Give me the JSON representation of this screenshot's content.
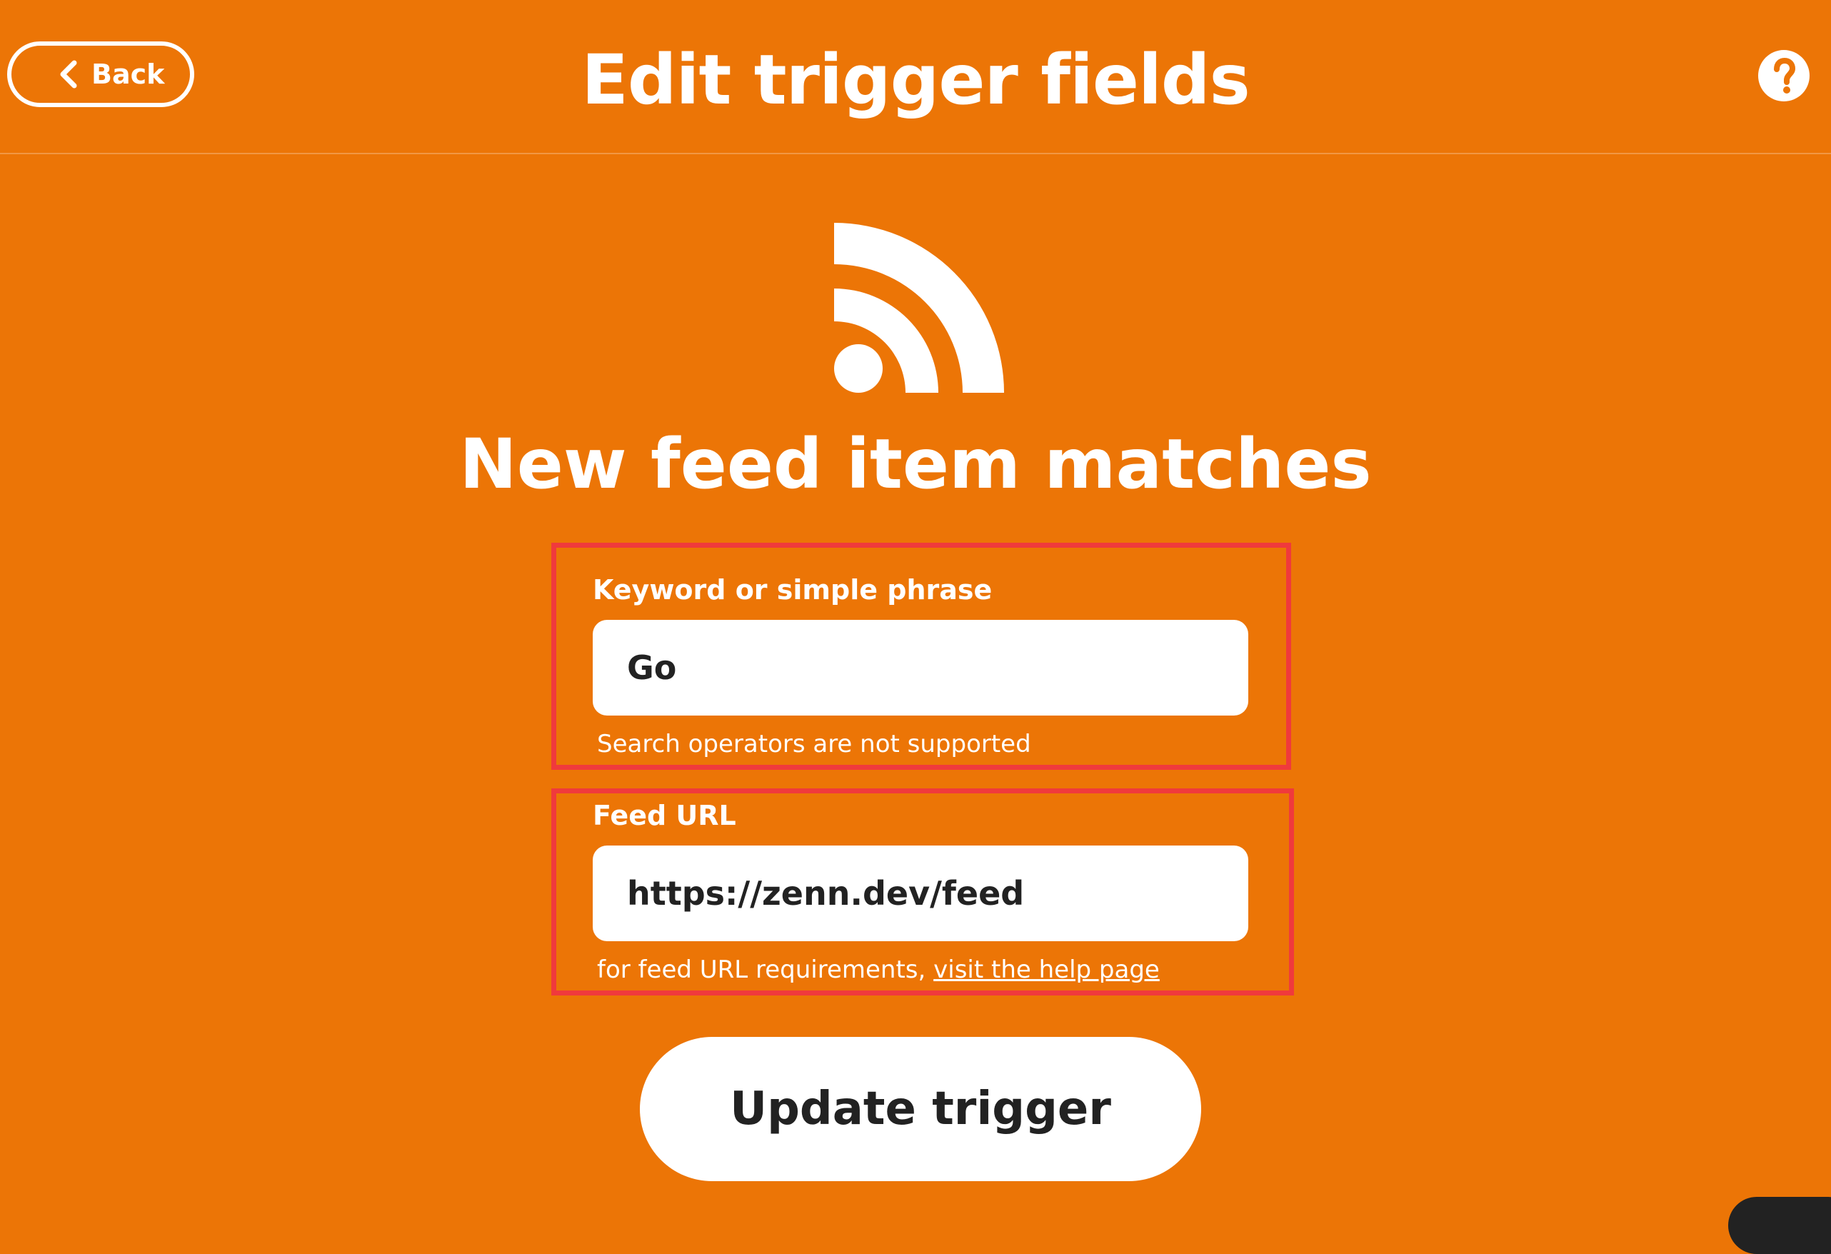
{
  "header": {
    "back_label": "Back",
    "title": "Edit trigger fields",
    "help_icon": "question-circle-icon"
  },
  "trigger": {
    "icon": "rss-feed-icon",
    "title": "New feed item matches"
  },
  "fields": [
    {
      "label": "Keyword or simple phrase",
      "value": "Go",
      "help_text": "Search operators are not supported"
    },
    {
      "label": "Feed URL",
      "value": "https://zenn.dev/feed",
      "help_text": "for feed URL requirements, ",
      "help_link": "visit the help page"
    }
  ],
  "actions": {
    "update_label": "Update trigger"
  },
  "colors": {
    "background": "#EC7506",
    "highlight": "#F03A3C",
    "text_dark": "#222222"
  }
}
